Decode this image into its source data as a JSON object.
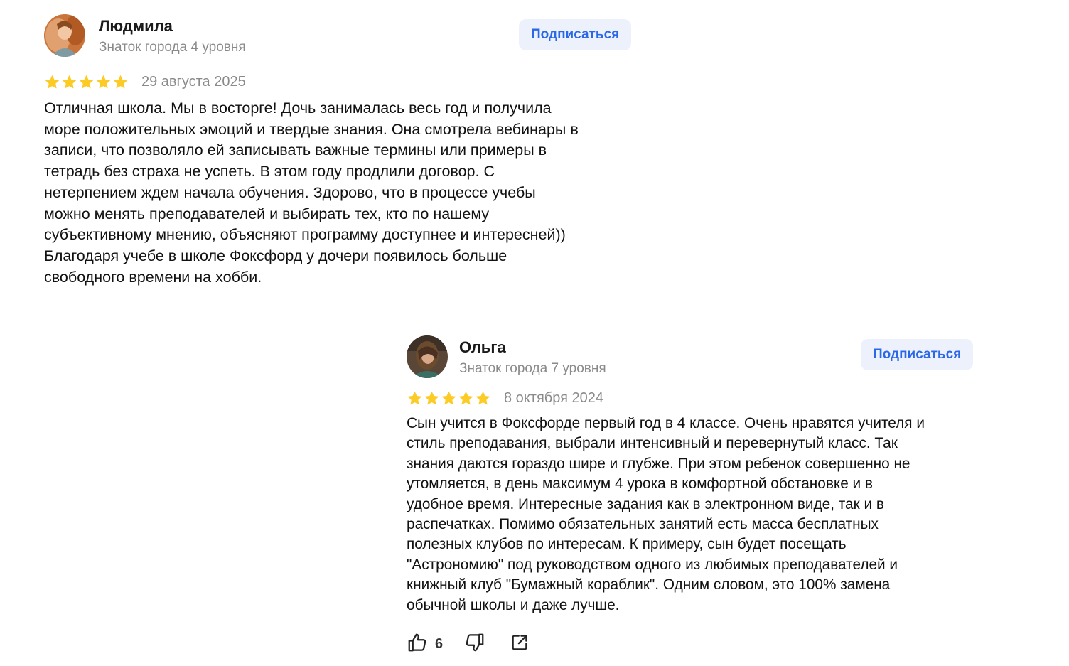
{
  "reviews": [
    {
      "author": "Людмила",
      "level": "Знаток города 4 уровня",
      "subscribe_label": "Подписаться",
      "rating": 5,
      "date": "29 августа 2025",
      "text": "Отличная школа. Мы в восторге! Дочь занималась весь год и получила\nморе положительных эмоций и твердые знания. Она смотрела вебинары в\nзаписи, что позволяло ей записывать важные термины или примеры в\nтетрадь без страха не успеть. В этом году продлили договор. С\nнетерпением ждем начала обучения. Здорово, что в процессе учебы\nможно менять преподавателей и выбирать тех, кто по нашему\nсубъективному мнению, объясняют программу доступнее и интересней))\nБлагодаря учебе в школе Фоксфорд у дочери появилось больше\nсвободного времени на хобби."
    },
    {
      "author": "Ольга",
      "level": "Знаток города 7 уровня",
      "subscribe_label": "Подписаться",
      "rating": 5,
      "date": "8 октября 2024",
      "text": "Сын учится в Фоксфорде первый год в 4 классе. Очень нравятся учителя и\nстиль преподавания, выбрали интенсивный и перевернутый класс. Так\nзнания даются гораздо шире и глубже. При этом ребенок совершенно не\nутомляется, в день максимум 4 урока в комфортной обстановке и в\nудобное время. Интересные задания как в электронном виде, так и в\nраспечатках. Помимо обязательных занятий есть масса бесплатных\nполезных клубов по интересам. К примеру, сын будет посещать\n\"Астрономию\" под руководством одного из любимых преподавателей и\nкнижный клуб \"Бумажный кораблик\". Одним словом, это 100% замена\nобычной школы и даже лучше.",
      "likes": "6"
    }
  ],
  "colors": {
    "star": "#fccb26",
    "subscribe_bg": "#ecf1fb",
    "subscribe_text": "#2a68e8",
    "muted": "#8a8a8a"
  },
  "icons": {
    "star": "star-icon",
    "like": "thumbs-up-icon",
    "dislike": "thumbs-down-icon",
    "share": "share-icon"
  }
}
